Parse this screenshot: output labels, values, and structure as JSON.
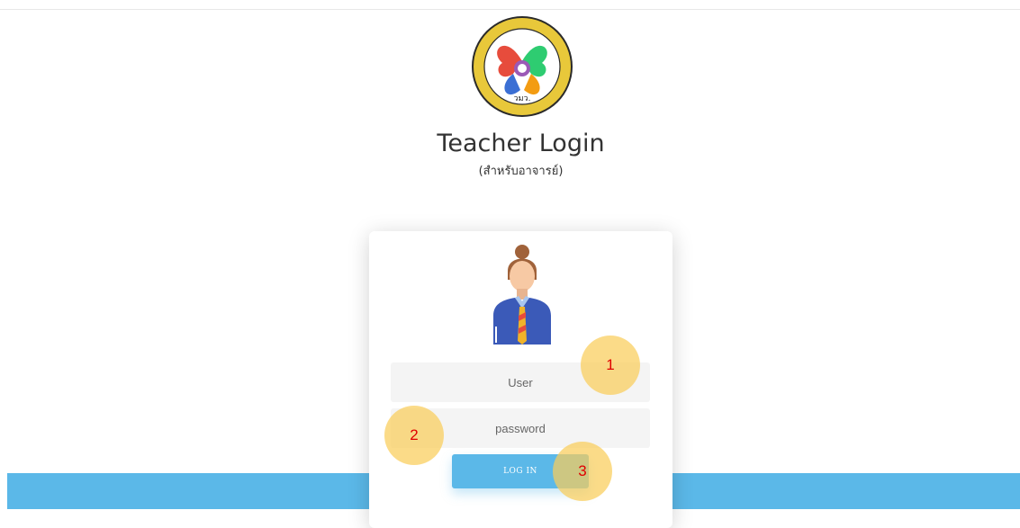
{
  "header": {
    "title": "Teacher Login",
    "subtitle": "(สำหรับอาจารย์)",
    "logo_icon": "school-emblem-icon",
    "logo_text": "วมว."
  },
  "login_form": {
    "avatar_icon": "teacher-avatar-icon",
    "user_placeholder": "User",
    "password_placeholder": "password",
    "login_label": "LOG IN"
  },
  "annotations": [
    {
      "label": "1"
    },
    {
      "label": "2"
    },
    {
      "label": "3"
    }
  ],
  "colors": {
    "accent_blue": "#5bb8e8",
    "marker_yellow": "#facd5a",
    "marker_text": "#e00000",
    "field_bg": "#f4f4f4"
  }
}
